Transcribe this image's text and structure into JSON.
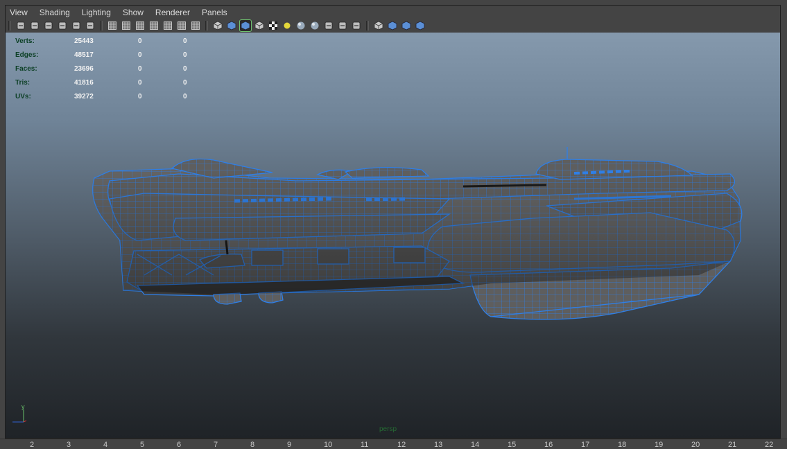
{
  "menu": [
    "View",
    "Shading",
    "Lighting",
    "Show",
    "Renderer",
    "Panels"
  ],
  "toolbar": {
    "groups": [
      [
        "select-camera-icon",
        "camera-attributes-icon",
        "bookmarks-icon",
        "image-plane-icon",
        "2d-pan-zoom-icon",
        "grease-pencil-icon"
      ],
      [
        "grid-icon",
        "film-gate-icon",
        "resolution-gate-icon",
        "gate-mask-icon",
        "field-chart-icon",
        "safe-action-icon",
        "safe-title-icon"
      ],
      [
        "wireframe-icon",
        "smooth-shade-icon",
        "wireframe-on-shaded-icon",
        "flat-shade-icon",
        "textured-icon",
        "use-all-lights-icon",
        "shadows-icon",
        "screen-space-ao-icon",
        "motion-blur-icon",
        "multisample-aa-icon",
        "depth-of-field-icon"
      ],
      [
        "isolate-select-icon",
        "xray-icon",
        "xray-active-components-icon",
        "xray-joints-icon"
      ]
    ],
    "active": "wireframe-on-shaded-icon"
  },
  "heads_up": {
    "rows": [
      {
        "label": "Verts:",
        "values": [
          "25443",
          "0",
          "0"
        ]
      },
      {
        "label": "Edges:",
        "values": [
          "48517",
          "0",
          "0"
        ]
      },
      {
        "label": "Faces:",
        "values": [
          "23696",
          "0",
          "0"
        ]
      },
      {
        "label": "Tris:",
        "values": [
          "41816",
          "0",
          "0"
        ]
      },
      {
        "label": "UVs:",
        "values": [
          "39272",
          "0",
          "0"
        ]
      }
    ]
  },
  "axis": {
    "label": "y"
  },
  "camera": {
    "label": "persp"
  },
  "timeline": {
    "ticks": [
      "2",
      "3",
      "4",
      "5",
      "6",
      "7",
      "8",
      "9",
      "10",
      "11",
      "12",
      "13",
      "14",
      "15",
      "16",
      "17",
      "18",
      "19",
      "20",
      "21",
      "22"
    ]
  },
  "colors": {
    "wireframe": "#2f7fe6",
    "hud_label": "#0b3f24",
    "hud_value": "#f2f2f2",
    "active_tool": "#6fc36f"
  }
}
